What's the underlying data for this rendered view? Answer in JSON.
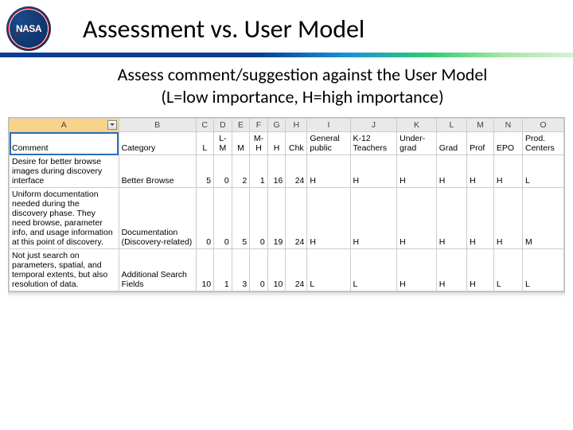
{
  "title": "Assessment vs. User Model",
  "subtitle_l1": "Assess comment/suggestion against the User Model",
  "subtitle_l2": "(L=low importance, H=high importance)",
  "cols": {
    "A": "A",
    "B": "B",
    "C": "C",
    "D": "D",
    "E": "E",
    "F": "F",
    "G": "G",
    "H": "H",
    "I": "I",
    "J": "J",
    "K": "K",
    "L": "L",
    "M": "M",
    "N": "N",
    "O": "O"
  },
  "hdr": {
    "A": "Comment",
    "B": "Category",
    "C": "L",
    "D": "L-M",
    "E": "M",
    "F": "M-H",
    "G": "H",
    "H": "Chk",
    "I": "General public",
    "J": "K-12 Teachers",
    "K": "Under-grad",
    "L": "Grad",
    "M": "Prof",
    "N": "EPO",
    "O": "Prod. Centers"
  },
  "rows": [
    {
      "A": "Desire for better browse images during discovery interface",
      "B": "Better Browse",
      "C": "5",
      "D": "0",
      "E": "2",
      "F": "1",
      "G": "16",
      "H": "24",
      "I": "H",
      "J": "H",
      "K": "H",
      "L": "H",
      "M": "H",
      "N": "H",
      "O": "L"
    },
    {
      "A": "Uniform documentation needed during the discovery phase. They need browse, parameter info, and usage information at this point of discovery.",
      "B": "Documentation (Discovery-related)",
      "C": "0",
      "D": "0",
      "E": "5",
      "F": "0",
      "G": "19",
      "H": "24",
      "I": "H",
      "J": "H",
      "K": "H",
      "L": "H",
      "M": "H",
      "N": "H",
      "O": "M"
    },
    {
      "A": "Not just search on parameters, spatial, and temporal extents, but also resolution of data.",
      "B": "Additional Search Fields",
      "C": "10",
      "D": "1",
      "E": "3",
      "F": "0",
      "G": "10",
      "H": "24",
      "I": "L",
      "J": "L",
      "K": "H",
      "L": "H",
      "M": "H",
      "N": "L",
      "O": "L"
    }
  ]
}
